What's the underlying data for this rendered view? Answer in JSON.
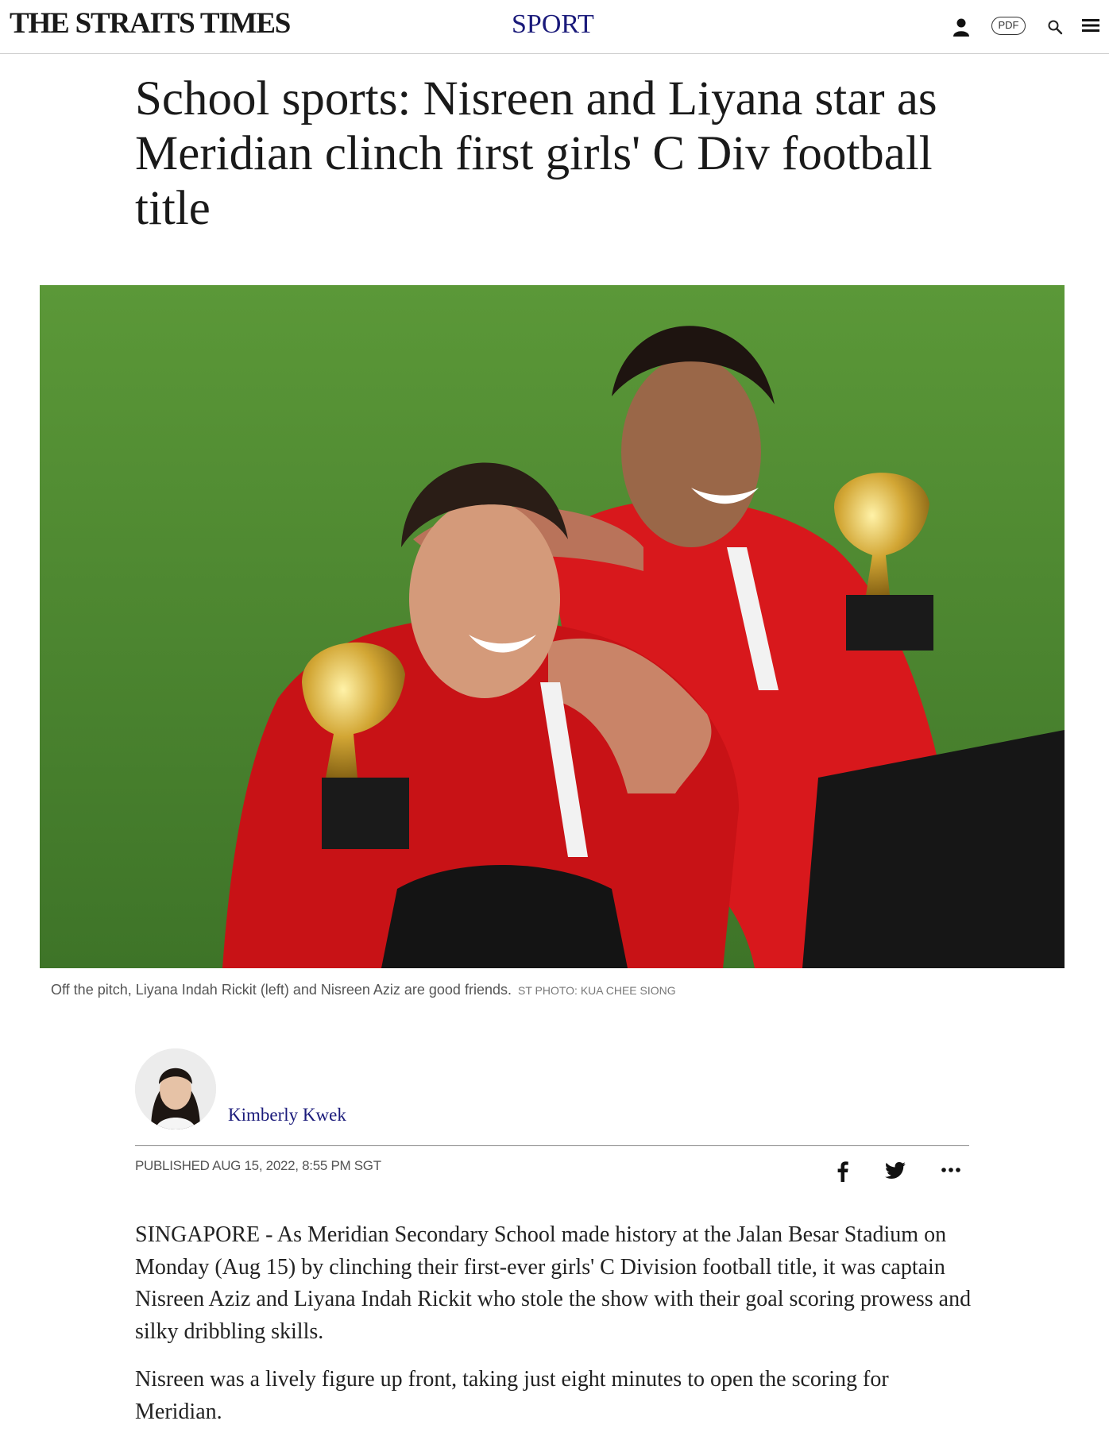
{
  "header": {
    "logo": "THE STRAITS TIMES",
    "section": "SPORT",
    "pdf_label": "PDF",
    "icons": [
      "user-icon",
      "pdf-icon",
      "search-icon",
      "menu-icon"
    ]
  },
  "article": {
    "headline": "School sports: Nisreen and Liyana star as Meridian clinch first girls' C Div football title",
    "photo": {
      "caption": "Off the pitch, Liyana Indah Rickit (left) and Nisreen Aziz are good friends.",
      "credit": "ST PHOTO: KUA CHEE SIONG"
    },
    "author": "Kimberly Kwek",
    "published": "PUBLISHED AUG 15, 2022, 8:55 PM SGT",
    "share_icons": [
      "facebook-icon",
      "twitter-icon",
      "more-icon"
    ],
    "paragraphs": [
      "SINGAPORE - As Meridian Secondary School made history at the Jalan Besar Stadium on Monday (Aug 15) by clinching their first-ever girls' C Division football title, it was captain Nisreen Aziz and Liyana Indah Rickit who stole the show with their goal scoring prowess and silky dribbling skills.",
      "Nisreen was a lively figure up front, taking just eight minutes to open the scoring for Meridian."
    ]
  },
  "colors": {
    "brand_navy": "#1a1a7a",
    "grass_green": "#4c8530",
    "jersey_red": "#d8181c"
  }
}
